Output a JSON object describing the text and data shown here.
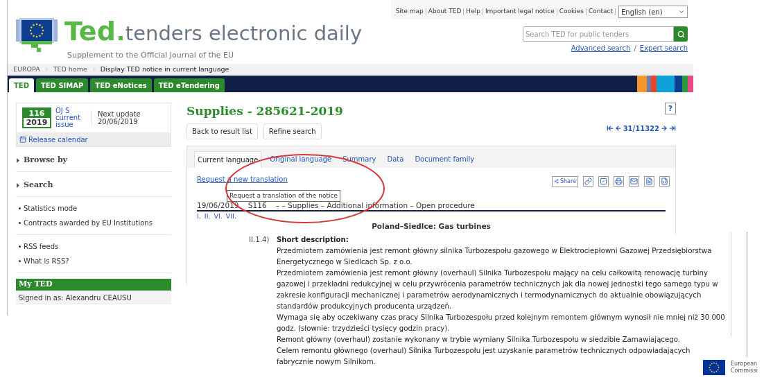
{
  "header": {
    "logo_word": "Ted",
    "logo_title": "tenders electronic daily",
    "subtitle": "Supplement to the Official Journal of the EU",
    "top_links": [
      "Site map",
      "About TED",
      "Help",
      "Important legal notice",
      "Cookies",
      "Contact"
    ],
    "language": "English (en)",
    "search": {
      "placeholder": "Search TED for public tenders"
    },
    "search_links": [
      "Advanced search",
      "Expert search"
    ],
    "search_links_separator": "/"
  },
  "breadcrumb": [
    "EUROPA",
    "TED home",
    "Display TED notice in current language"
  ],
  "nav_tabs": [
    {
      "label": "TED",
      "selected": true
    },
    {
      "label": "TED SIMAP",
      "selected": false
    },
    {
      "label": "TED eNotices",
      "selected": false
    },
    {
      "label": "TED eTendering",
      "selected": false
    }
  ],
  "sidebar": {
    "issue_number": "116",
    "issue_year": "2019",
    "issue_label": "OJ S current issue",
    "next_update": "Next update 20/06/2019",
    "release_calendar": "Release calendar",
    "sections": [
      {
        "label": "Browse by",
        "expanded": false
      },
      {
        "label": "Search",
        "expanded": false
      }
    ],
    "link_groups": [
      [
        "Statistics mode",
        "Contracts awarded by EU Institutions"
      ],
      [
        "RSS feeds",
        "What is RSS?"
      ]
    ],
    "my_ted": {
      "title": "My TED",
      "signed_in": "Signed in as: Alexandru CEAUSU"
    }
  },
  "main": {
    "title": "Supplies - 285621-2019",
    "help": "?",
    "buttons": [
      "Back to result list",
      "Refine search"
    ],
    "pager": "31/11322",
    "notice_tabs": [
      {
        "label": "Current language",
        "selected": true
      },
      {
        "label": "Original language",
        "selected": false
      },
      {
        "label": "Summary",
        "selected": false
      },
      {
        "label": "Data",
        "selected": false
      },
      {
        "label": "Document family",
        "selected": false
      }
    ],
    "request_link": "Request a new translation",
    "share": "Share",
    "tooltip": "Request a translation of the notice",
    "notice_header": "19/06/2019    S116    – – Supplies – Additional information – Open procedure",
    "section_links": [
      "I.",
      "II.",
      "VI.",
      "VII."
    ],
    "place_heading": "Poland–Siedlce: Gas turbines"
  },
  "description": {
    "number": "II.1.4)",
    "label": "Short description:",
    "paragraphs": [
      "Przedmiotem zamówienia jest remont główny silnika Turbozespołu gazowego w Elektrociepłowni Gazowej Przedsiębiorstwa Energetycznego w Siedlcach Sp. z o.o.",
      "Przedmiotem zamówienia jest remont główny (overhaul) Silnika Turbozespołu mający na celu całkowitą renowację turbiny gazowej i przekładni redukcyjnej w celu przywrócenia parametrów technicznych jak dla nowej jednostki tego samego typu w zakresie konfiguracji mechanicznej i parametrów aerodynamicznych i termodynamicznych do aktualnie obowiązujących standardów produkcyjnych producenta urządzeń.",
      "Wymaga się aby oczekiwany czas pracy Silnika Turbozespołu przed kolejnym remontem głównym wynosił nie mniej niż 30 000 godz. (słownie: trzydzieści tysięcy godzin pracy).",
      "Remont główny (overhaul) zostanie wykonany w trybie wymiany Silnika Turbozespołu w siedzibie Zamawiającego.",
      "Celem remontu głównego (overhaul) Silnika Turbozespołu jest uzyskanie parametrów technicznych odpowiadających fabrycznie nowym Silnikom."
    ]
  },
  "footer_logo": {
    "lines": [
      "European",
      "Commissi"
    ]
  }
}
